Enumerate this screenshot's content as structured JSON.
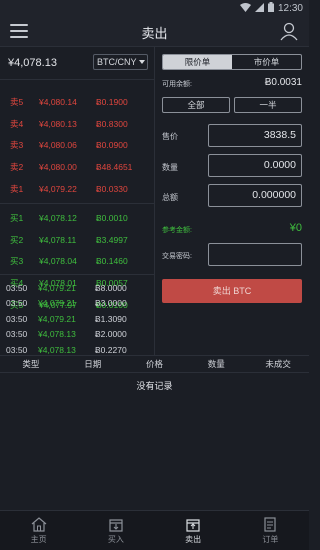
{
  "status": {
    "time": "12:30"
  },
  "header": {
    "title": "卖出"
  },
  "market": {
    "price": "¥4,078.13",
    "pair": "BTC/CNY"
  },
  "orderbook": {
    "asks": [
      {
        "label": "卖5",
        "price": "¥4,080.14",
        "qty": "Ƀ0.1900"
      },
      {
        "label": "卖4",
        "price": "¥4,080.13",
        "qty": "Ƀ0.8300"
      },
      {
        "label": "卖3",
        "price": "¥4,080.06",
        "qty": "Ƀ0.0900"
      },
      {
        "label": "卖2",
        "price": "¥4,080.00",
        "qty": "Ƀ48.4651"
      },
      {
        "label": "卖1",
        "price": "¥4,079.22",
        "qty": "Ƀ0.0330"
      }
    ],
    "bids": [
      {
        "label": "买1",
        "price": "¥4,078.12",
        "qty": "Ƀ0.0010"
      },
      {
        "label": "买2",
        "price": "¥4,078.11",
        "qty": "Ƀ3.4997"
      },
      {
        "label": "买3",
        "price": "¥4,078.04",
        "qty": "Ƀ0.1460"
      },
      {
        "label": "买4",
        "price": "¥4,078.01",
        "qty": "Ƀ0.0057"
      },
      {
        "label": "买5",
        "price": "¥4,077.97",
        "qty": "Ƀ0.0100"
      }
    ]
  },
  "trades": [
    {
      "time": "03:50",
      "price": "¥4,079.21",
      "qty": "Ƀ8.0000"
    },
    {
      "time": "03:50",
      "price": "¥4,079.21",
      "qty": "Ƀ3.0000"
    },
    {
      "time": "03:50",
      "price": "¥4,079.21",
      "qty": "Ƀ1.3090"
    },
    {
      "time": "03:50",
      "price": "¥4,078.13",
      "qty": "Ƀ2.0000"
    },
    {
      "time": "03:50",
      "price": "¥4,078.13",
      "qty": "Ƀ0.2270"
    }
  ],
  "order_form": {
    "tab_limit": "限价单",
    "tab_market": "市价单",
    "available_label": "可用余额:",
    "available_value": "Ƀ0.0031",
    "all_label": "全部",
    "half_label": "一半",
    "price_label": "售价",
    "price_value": "3838.5",
    "qty_label": "数量",
    "qty_value": "0.0000",
    "total_label": "总额",
    "total_value": "0.000000",
    "ref_label": "参考金额:",
    "ref_value": "¥0",
    "pwd_label": "交易密码:",
    "pwd_value": "",
    "submit_label": "卖出 BTC"
  },
  "table": {
    "headers": [
      "类型",
      "日期",
      "价格",
      "数量",
      "未成交"
    ],
    "empty_text": "没有记录"
  },
  "tabbar": {
    "items": [
      {
        "label": "主页",
        "icon": "home-icon"
      },
      {
        "label": "买入",
        "icon": "buy-icon"
      },
      {
        "label": "卖出",
        "icon": "sell-icon"
      },
      {
        "label": "订单",
        "icon": "orders-icon"
      }
    ]
  }
}
